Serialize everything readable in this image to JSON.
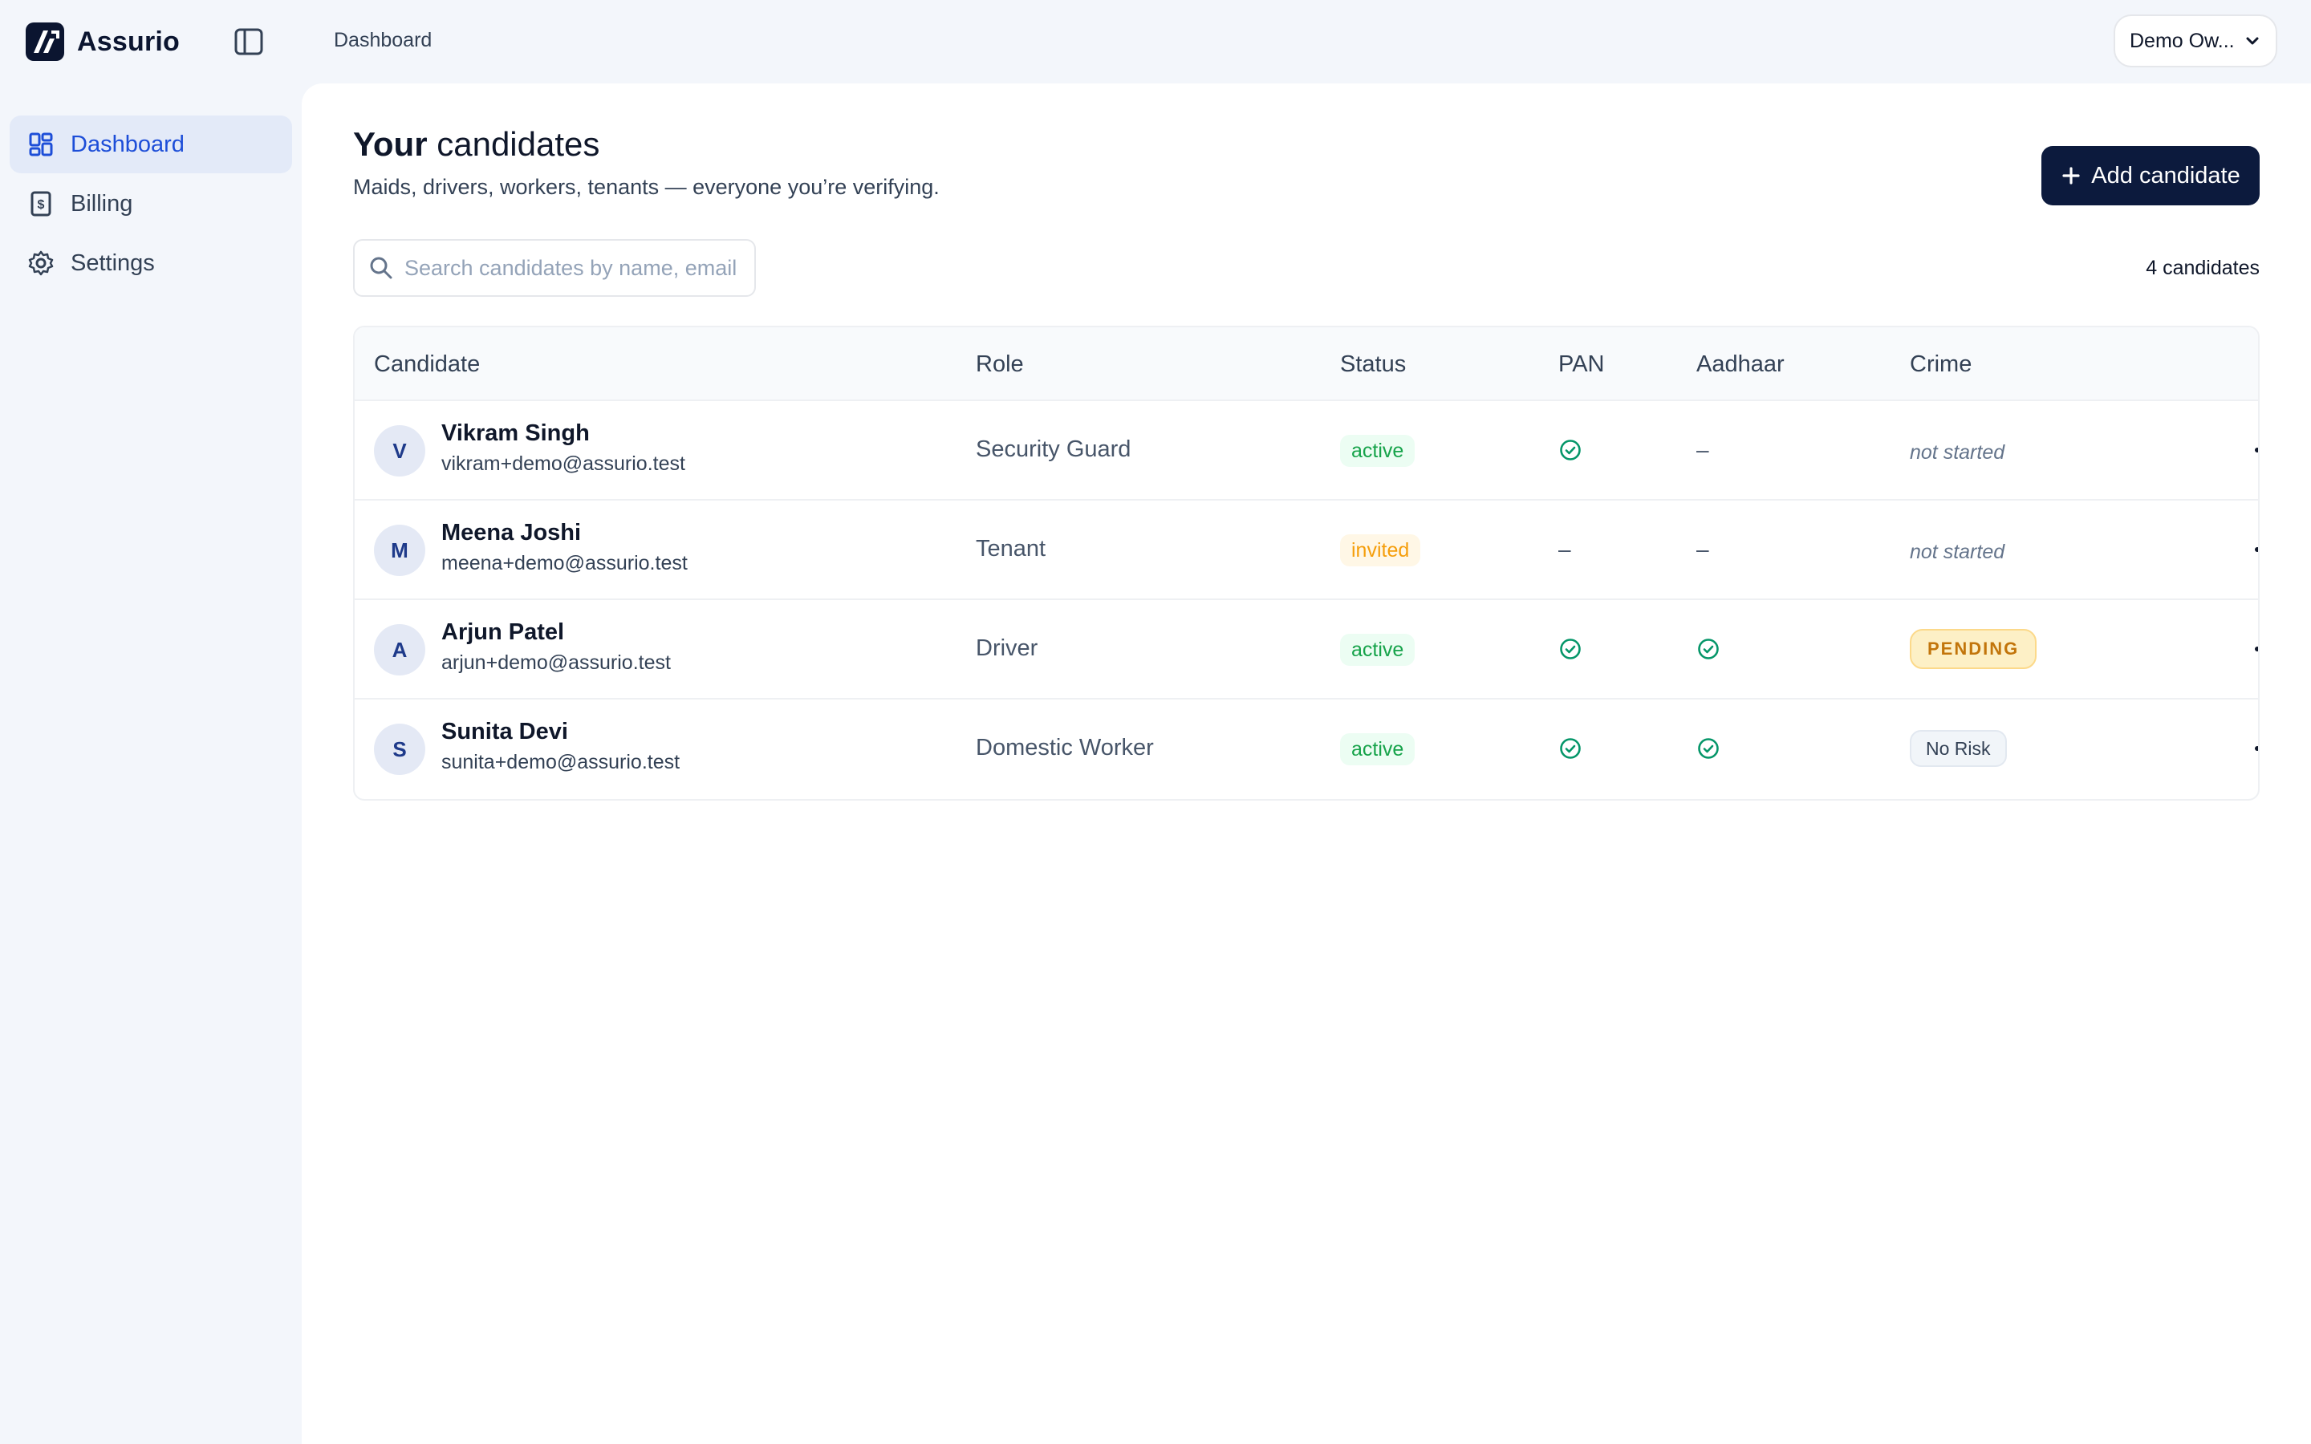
{
  "app": {
    "name": "Assurio"
  },
  "breadcrumb": "Dashboard",
  "user_menu": {
    "label": "Demo Ow..."
  },
  "sidebar": {
    "items": [
      {
        "label": "Dashboard",
        "icon": "dashboard-icon",
        "active": true
      },
      {
        "label": "Billing",
        "icon": "billing-icon",
        "active": false
      },
      {
        "label": "Settings",
        "icon": "gear-icon",
        "active": false
      }
    ]
  },
  "page": {
    "title_bold": "Your",
    "title_rest": " candidates",
    "subtitle": "Maids, drivers, workers, tenants — everyone you’re verifying.",
    "add_button": "Add candidate",
    "search_placeholder": "Search candidates by name, email...",
    "count": "4 candidates"
  },
  "table": {
    "headers": {
      "candidate": "Candidate",
      "role": "Role",
      "status": "Status",
      "pan": "PAN",
      "aadhaar": "Aadhaar",
      "crime": "Crime"
    },
    "rows": [
      {
        "initial": "V",
        "name": "Vikram Singh",
        "email": "vikram+demo@assurio.test",
        "role": "Security Guard",
        "status": "active",
        "pan": "✓",
        "aadhaar": "–",
        "crime": "not started"
      },
      {
        "initial": "M",
        "name": "Meena Joshi",
        "email": "meena+demo@assurio.test",
        "role": "Tenant",
        "status": "invited",
        "pan": "–",
        "aadhaar": "–",
        "crime": "not started"
      },
      {
        "initial": "A",
        "name": "Arjun Patel",
        "email": "arjun+demo@assurio.test",
        "role": "Driver",
        "status": "active",
        "pan": "✓",
        "aadhaar": "✓",
        "crime": "PENDING"
      },
      {
        "initial": "S",
        "name": "Sunita Devi",
        "email": "sunita+demo@assurio.test",
        "role": "Domestic Worker",
        "status": "active",
        "pan": "✓",
        "aadhaar": "✓",
        "crime": "No Risk"
      }
    ]
  },
  "colors": {
    "primary_button": "#0c1a3d",
    "active_nav_bg": "#e3eaf8",
    "active_nav_text": "#1d4ed8",
    "status_active": "#16a34a",
    "status_invited": "#f59e0b",
    "check_green": "#059669"
  }
}
